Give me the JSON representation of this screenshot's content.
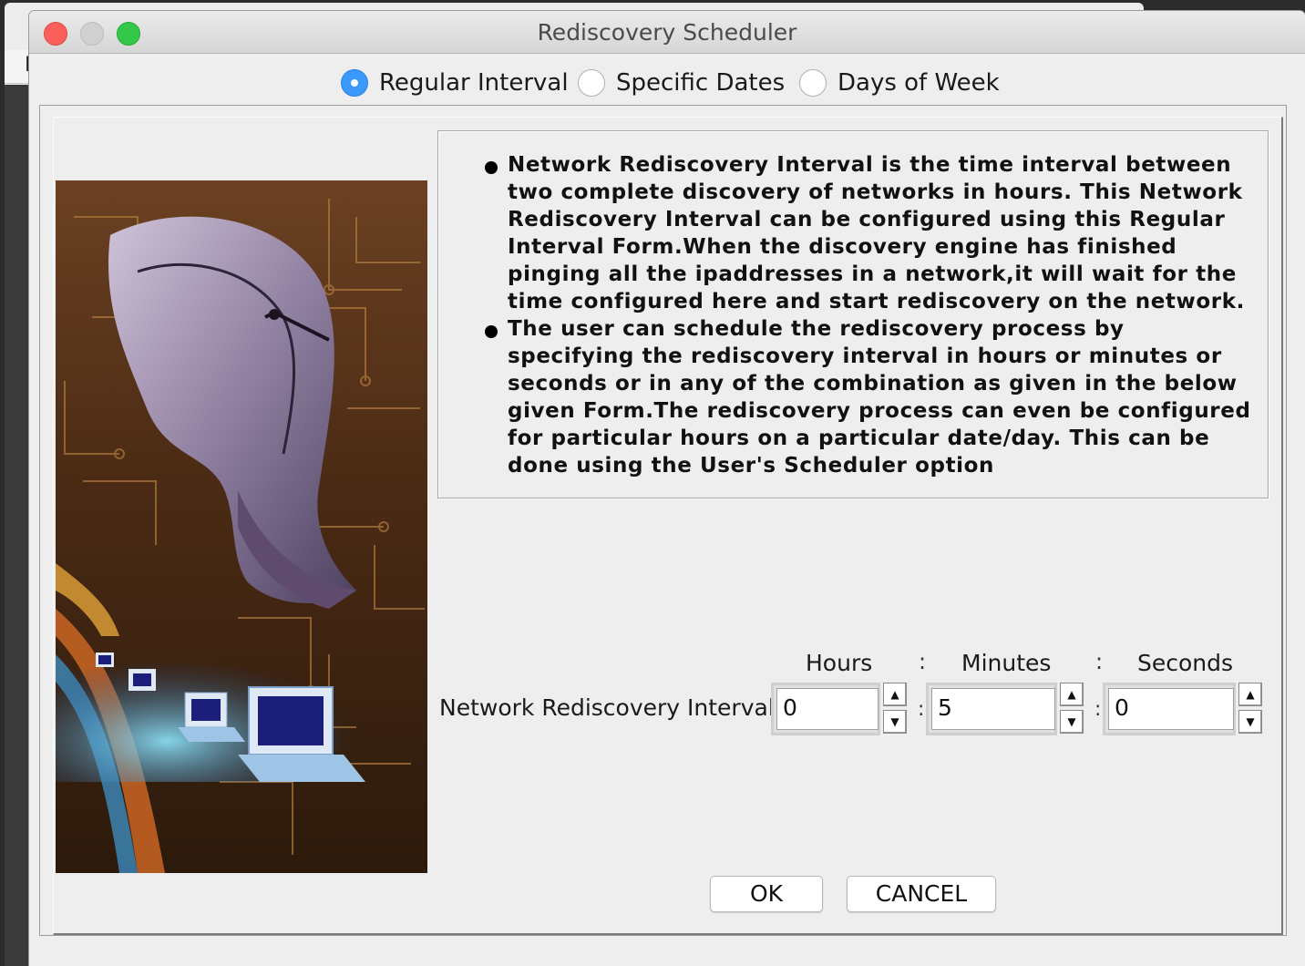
{
  "window": {
    "title": "Rediscovery Scheduler"
  },
  "background_window": {
    "menu_letter": "F"
  },
  "schedule_modes": {
    "selected": "Regular Interval",
    "options": [
      "Regular Interval",
      "Specific Dates",
      "Days of Week"
    ]
  },
  "info": {
    "bullets": [
      "Network Rediscovery Interval is the time interval between two complete discovery of networks in hours. This Network Rediscovery Interval can be configured using this Regular Interval Form.When the discovery engine has finished pinging all the ipaddresses in a network,it will wait for the time configured here and start rediscovery on the network.",
      "The user can schedule the rediscovery process by specifying the rediscovery interval in hours or minutes or seconds or in any of the combination as given in the below given Form.The rediscovery process can even be configured for particular hours on a particular date/day. This can be done using the User's Scheduler option"
    ]
  },
  "interval": {
    "label": "Network Rediscovery Interval",
    "separator": ":",
    "hours": {
      "header": "Hours",
      "value": "0"
    },
    "minutes": {
      "header": "Minutes",
      "value": "5"
    },
    "seconds": {
      "header": "Seconds",
      "value": "0"
    }
  },
  "buttons": {
    "ok": "OK",
    "cancel": "CANCEL"
  },
  "icons": {
    "radio_selected": "radio-selected-icon",
    "spinner_up": "spinner-up-icon",
    "spinner_down": "spinner-down-icon",
    "bullet": "bullet-icon"
  },
  "colors": {
    "accent_radio": "#3b99fc",
    "close": "#fc605c",
    "zoom": "#34c84a",
    "dialog_bg": "#eeeeee"
  }
}
